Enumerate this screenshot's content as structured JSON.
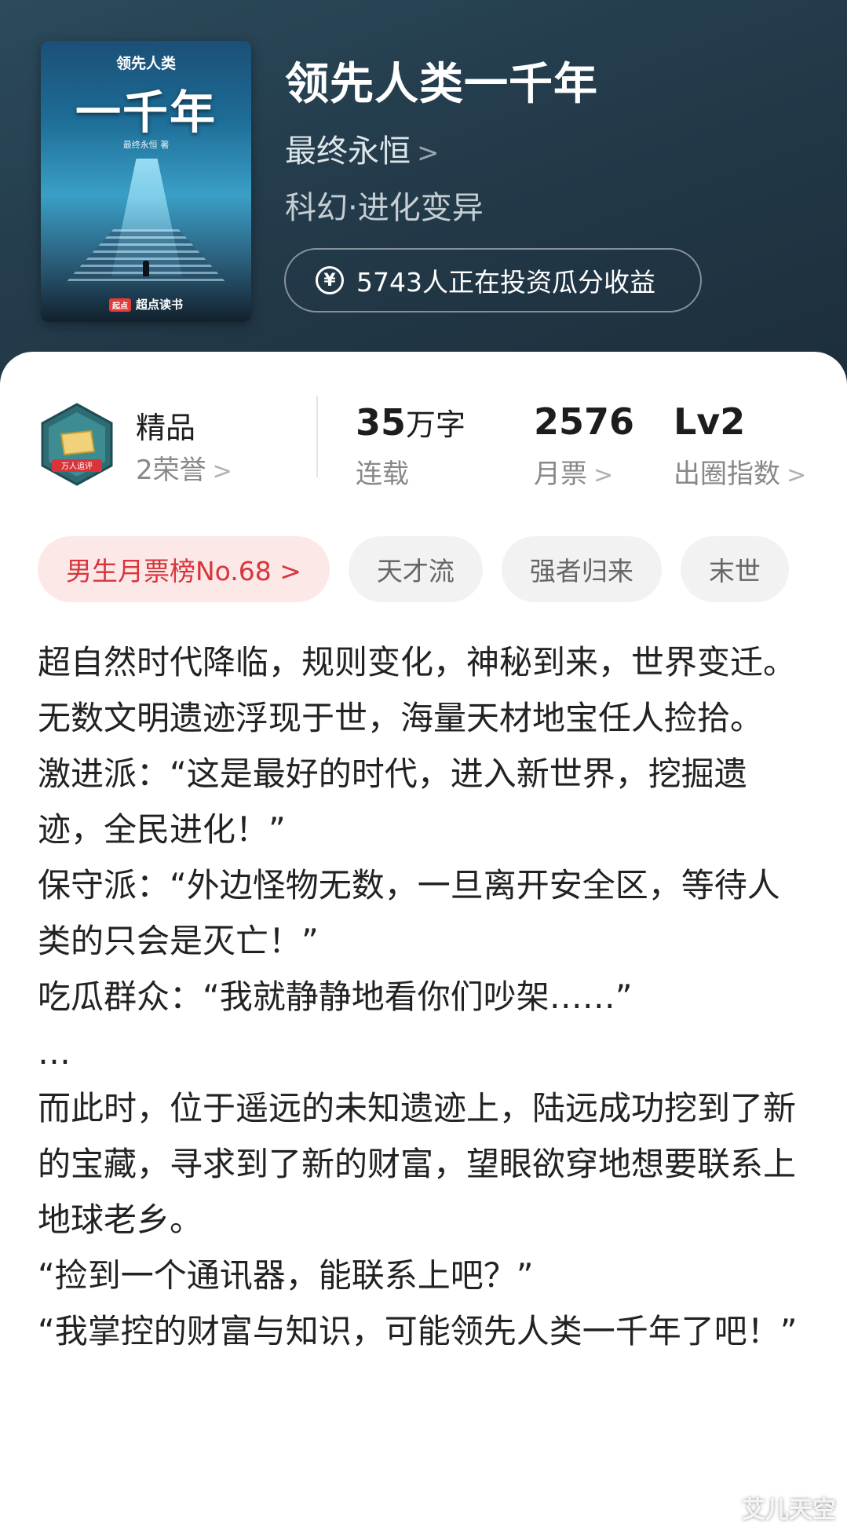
{
  "book": {
    "title": "领先人类一千年",
    "author": "最终永恒",
    "genre": "科幻·进化变异",
    "invest_text": "5743人正在投资瓜分收益",
    "cover": {
      "small_title": "领先人类",
      "big_title": "一千年",
      "author_line": "最终永恒 著",
      "publisher": "超点读书",
      "publisher_logo": "起点"
    }
  },
  "stats": {
    "quality": "精品",
    "honors": "2荣誉",
    "badge_text": "万人追评",
    "words_value": "35",
    "words_unit": "万字",
    "status": "连载",
    "tickets_value": "2576",
    "tickets_label": "月票",
    "level_value": "Lv2",
    "level_label": "出圈指数"
  },
  "tags": {
    "rank": "男生月票榜No.68 >",
    "items": [
      "天才流",
      "强者归来",
      "末世"
    ]
  },
  "description": [
    "超自然时代降临，规则变化，神秘到来，世界变迁。",
    "无数文明遗迹浮现于世，海量天材地宝任人捡拾。",
    "激进派：“这是最好的时代，进入新世界，挖掘遗迹，全民进化！”",
    "保守派：“外边怪物无数，一旦离开安全区，等待人类的只会是灭亡！”",
    "吃瓜群众：“我就静静地看你们吵架……”",
    "…",
    "而此时，位于遥远的未知遗迹上，陆远成功挖到了新的宝藏，寻求到了新的财富，望眼欲穿地想要联系上地球老乡。",
    "“捡到一个通讯器，能联系上吧？”",
    "“我掌控的财富与知识，可能领先人类一千年了吧！”"
  ],
  "watermark": "艾儿天空",
  "colors": {
    "header_bg": "#243c4c",
    "rank_tag_bg": "#fde8e8",
    "rank_tag_text": "#d9343b",
    "tag_bg": "#f2f2f2"
  }
}
